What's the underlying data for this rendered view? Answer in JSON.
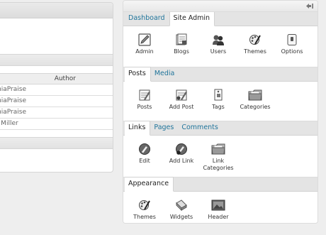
{
  "author_table": {
    "column_header": "Author",
    "rows": [
      "miaPraise",
      "miaPraise",
      "miaPraise",
      "y Miller"
    ]
  },
  "sections": [
    {
      "tabs": [
        {
          "label": "Dashboard",
          "active": false
        },
        {
          "label": "Site Admin",
          "active": true
        }
      ],
      "items": [
        {
          "label": "Admin",
          "icon": "edit-icon"
        },
        {
          "label": "Blogs",
          "icon": "blogs-icon"
        },
        {
          "label": "Users",
          "icon": "users-icon"
        },
        {
          "label": "Themes",
          "icon": "themes-icon"
        },
        {
          "label": "Options",
          "icon": "options-icon"
        }
      ]
    },
    {
      "tabs": [
        {
          "label": "Posts",
          "active": true
        },
        {
          "label": "Media",
          "active": false
        }
      ],
      "items": [
        {
          "label": "Posts",
          "icon": "posts-icon"
        },
        {
          "label": "Add Post",
          "icon": "add-post-icon"
        },
        {
          "label": "Tags",
          "icon": "tags-icon"
        },
        {
          "label": "Categories",
          "icon": "folder-icon"
        }
      ]
    },
    {
      "tabs": [
        {
          "label": "Links",
          "active": true
        },
        {
          "label": "Pages",
          "active": false
        },
        {
          "label": "Comments",
          "active": false
        }
      ],
      "items": [
        {
          "label": "Edit",
          "icon": "link-edit-icon"
        },
        {
          "label": "Add Link",
          "icon": "link-add-icon"
        },
        {
          "label": "Link Categories",
          "icon": "folder-icon"
        }
      ]
    },
    {
      "tabs": [
        {
          "label": "Appearance",
          "active": true
        }
      ],
      "items": [
        {
          "label": "Themes",
          "icon": "themes-icon"
        },
        {
          "label": "Widgets",
          "icon": "widgets-icon"
        },
        {
          "label": "Header",
          "icon": "header-image-icon"
        }
      ]
    }
  ],
  "colors": {
    "link": "#21759b",
    "panel_bg": "#f7f7f7",
    "tab_bar_bg": "#e4e4e4"
  }
}
